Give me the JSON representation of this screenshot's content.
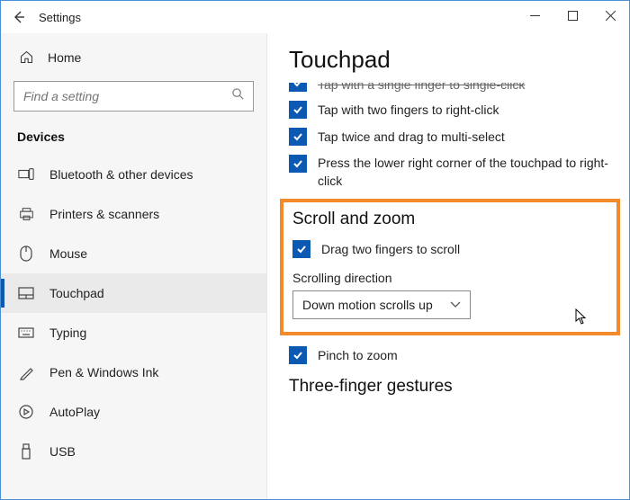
{
  "window": {
    "title": "Settings"
  },
  "sidebar": {
    "home": "Home",
    "search_placeholder": "Find a setting",
    "section": "Devices",
    "items": [
      {
        "label": "Bluetooth & other devices"
      },
      {
        "label": "Printers & scanners"
      },
      {
        "label": "Mouse"
      },
      {
        "label": "Touchpad"
      },
      {
        "label": "Typing"
      },
      {
        "label": "Pen & Windows Ink"
      },
      {
        "label": "AutoPlay"
      },
      {
        "label": "USB"
      }
    ]
  },
  "page": {
    "title": "Touchpad",
    "truncated_option": "Tap with a single finger to single-click",
    "options": [
      "Tap with two fingers to right-click",
      "Tap twice and drag to multi-select",
      "Press the lower right corner of the touchpad to right-click"
    ],
    "scroll_section": {
      "title": "Scroll and zoom",
      "drag_option": "Drag two fingers to scroll",
      "direction_label": "Scrolling direction",
      "direction_value": "Down motion scrolls up"
    },
    "pinch_option": "Pinch to zoom",
    "three_finger_title": "Three-finger gestures"
  }
}
